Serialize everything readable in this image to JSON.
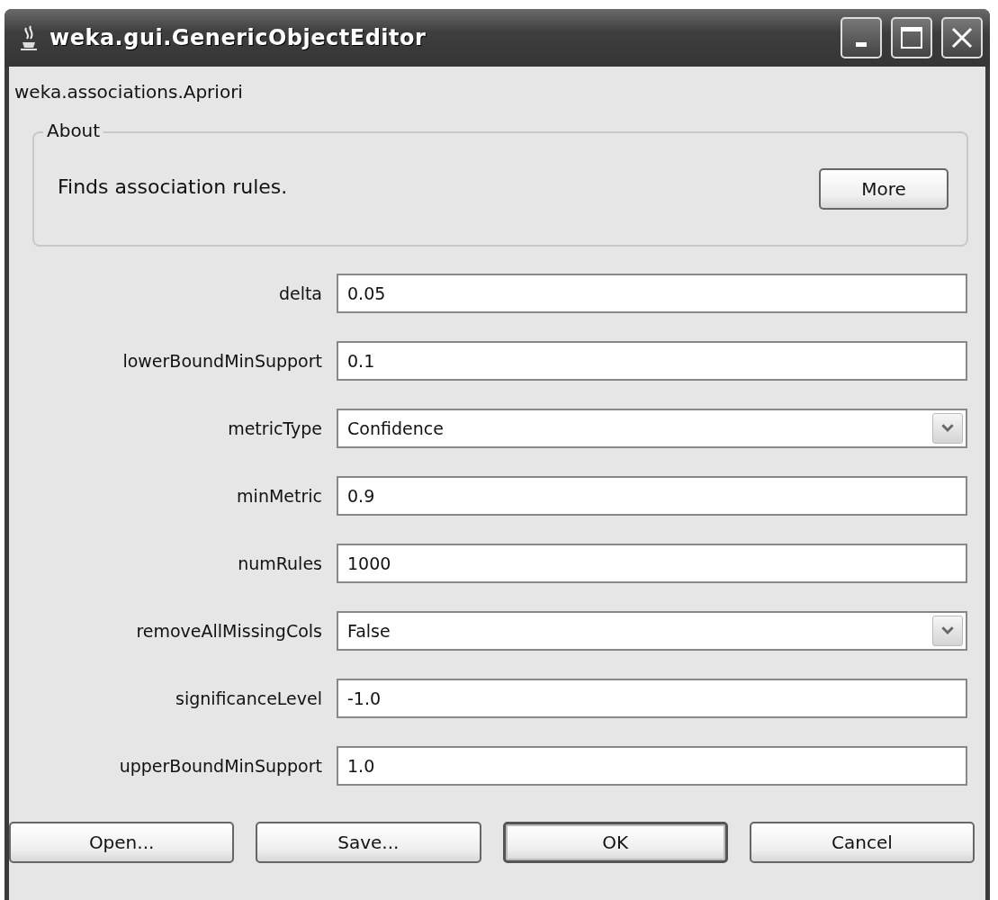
{
  "window": {
    "title": "weka.gui.GenericObjectEditor"
  },
  "class_name": "weka.associations.Apriori",
  "about": {
    "title": "About",
    "text": "Finds association rules.",
    "button": "More"
  },
  "properties": [
    {
      "label": "delta",
      "kind": "text",
      "value": "0.05"
    },
    {
      "label": "lowerBoundMinSupport",
      "kind": "text",
      "value": "0.1"
    },
    {
      "label": "metricType",
      "kind": "choice",
      "value": "Confidence"
    },
    {
      "label": "minMetric",
      "kind": "text",
      "value": "0.9"
    },
    {
      "label": "numRules",
      "kind": "text",
      "value": "1000"
    },
    {
      "label": "removeAllMissingCols",
      "kind": "choice",
      "value": "False"
    },
    {
      "label": "significanceLevel",
      "kind": "text",
      "value": "-1.0"
    },
    {
      "label": "upperBoundMinSupport",
      "kind": "text",
      "value": "1.0"
    }
  ],
  "buttons": [
    {
      "label": "Open...",
      "default": false
    },
    {
      "label": "Save...",
      "default": false
    },
    {
      "label": "OK",
      "default": true
    },
    {
      "label": "Cancel",
      "default": false
    }
  ]
}
